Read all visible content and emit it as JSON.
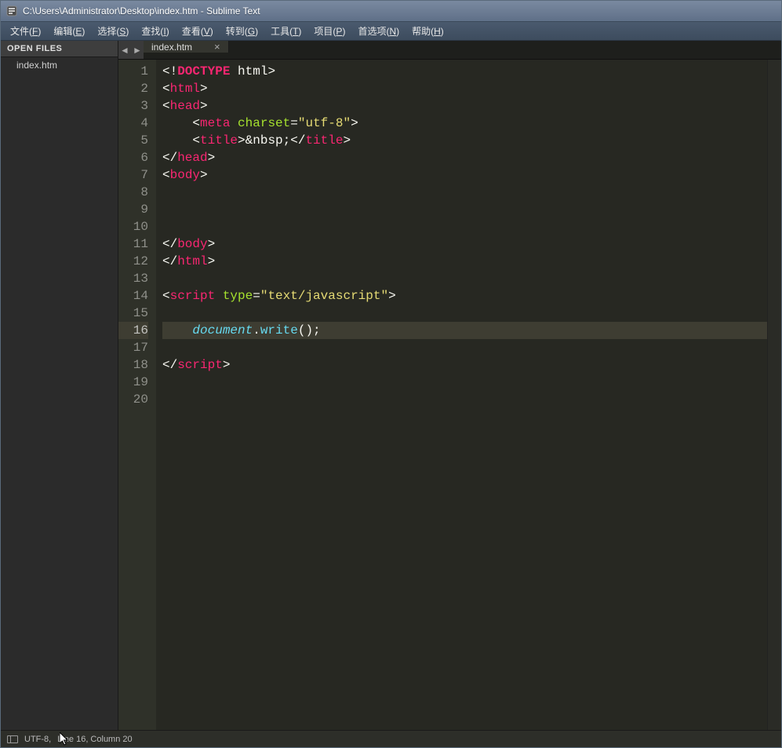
{
  "titlebar": {
    "title": "C:\\Users\\Administrator\\Desktop\\index.htm - Sublime Text"
  },
  "menu": {
    "items": [
      {
        "label": "文件",
        "key": "F"
      },
      {
        "label": "编辑",
        "key": "E"
      },
      {
        "label": "选择",
        "key": "S"
      },
      {
        "label": "查找",
        "key": "I"
      },
      {
        "label": "查看",
        "key": "V"
      },
      {
        "label": "转到",
        "key": "G"
      },
      {
        "label": "工具",
        "key": "T"
      },
      {
        "label": "项目",
        "key": "P"
      },
      {
        "label": "首选项",
        "key": "N"
      },
      {
        "label": "帮助",
        "key": "H"
      }
    ]
  },
  "sidebar": {
    "header": "OPEN FILES",
    "files": [
      "index.htm"
    ]
  },
  "tabs": {
    "items": [
      {
        "label": "index.htm"
      }
    ]
  },
  "editor": {
    "activeLine": 16,
    "lines": [
      {
        "n": 1,
        "tokens": [
          {
            "t": "<!",
            "c": "c-white"
          },
          {
            "t": "DOCTYPE",
            "c": "c-doctype"
          },
          {
            "t": " ",
            "c": "c-white"
          },
          {
            "t": "html",
            "c": "c-white"
          },
          {
            "t": ">",
            "c": "c-white"
          }
        ]
      },
      {
        "n": 2,
        "tokens": [
          {
            "t": "<",
            "c": "c-white"
          },
          {
            "t": "html",
            "c": "c-red"
          },
          {
            "t": ">",
            "c": "c-white"
          }
        ]
      },
      {
        "n": 3,
        "tokens": [
          {
            "t": "<",
            "c": "c-white"
          },
          {
            "t": "head",
            "c": "c-red"
          },
          {
            "t": ">",
            "c": "c-white"
          }
        ]
      },
      {
        "n": 4,
        "tokens": [
          {
            "t": "    <",
            "c": "c-white"
          },
          {
            "t": "meta",
            "c": "c-red"
          },
          {
            "t": " ",
            "c": "c-white"
          },
          {
            "t": "charset",
            "c": "c-attr"
          },
          {
            "t": "=",
            "c": "c-white"
          },
          {
            "t": "\"utf-8\"",
            "c": "c-str"
          },
          {
            "t": ">",
            "c": "c-white"
          }
        ]
      },
      {
        "n": 5,
        "tokens": [
          {
            "t": "    <",
            "c": "c-white"
          },
          {
            "t": "title",
            "c": "c-red"
          },
          {
            "t": ">",
            "c": "c-white"
          },
          {
            "t": "&nbsp;",
            "c": "c-white"
          },
          {
            "t": "</",
            "c": "c-white"
          },
          {
            "t": "title",
            "c": "c-red"
          },
          {
            "t": ">",
            "c": "c-white"
          }
        ]
      },
      {
        "n": 6,
        "tokens": [
          {
            "t": "</",
            "c": "c-white"
          },
          {
            "t": "head",
            "c": "c-red"
          },
          {
            "t": ">",
            "c": "c-white"
          }
        ]
      },
      {
        "n": 7,
        "tokens": [
          {
            "t": "<",
            "c": "c-white"
          },
          {
            "t": "body",
            "c": "c-red"
          },
          {
            "t": ">",
            "c": "c-white"
          }
        ]
      },
      {
        "n": 8,
        "tokens": []
      },
      {
        "n": 9,
        "tokens": []
      },
      {
        "n": 10,
        "tokens": []
      },
      {
        "n": 11,
        "tokens": [
          {
            "t": "</",
            "c": "c-white"
          },
          {
            "t": "body",
            "c": "c-red"
          },
          {
            "t": ">",
            "c": "c-white"
          }
        ]
      },
      {
        "n": 12,
        "tokens": [
          {
            "t": "</",
            "c": "c-white"
          },
          {
            "t": "html",
            "c": "c-red"
          },
          {
            "t": ">",
            "c": "c-white"
          }
        ]
      },
      {
        "n": 13,
        "tokens": []
      },
      {
        "n": 14,
        "tokens": [
          {
            "t": "<",
            "c": "c-white"
          },
          {
            "t": "script",
            "c": "c-red"
          },
          {
            "t": " ",
            "c": "c-white"
          },
          {
            "t": "type",
            "c": "c-attr"
          },
          {
            "t": "=",
            "c": "c-white"
          },
          {
            "t": "\"text/javascript\"",
            "c": "c-str"
          },
          {
            "t": ">",
            "c": "c-white"
          }
        ]
      },
      {
        "n": 15,
        "tokens": []
      },
      {
        "n": 16,
        "tokens": [
          {
            "t": "    ",
            "c": "c-white"
          },
          {
            "t": "document",
            "c": "c-var"
          },
          {
            "t": ".",
            "c": "c-white"
          },
          {
            "t": "write",
            "c": "c-func"
          },
          {
            "t": "();",
            "c": "c-white"
          }
        ]
      },
      {
        "n": 17,
        "tokens": []
      },
      {
        "n": 18,
        "tokens": [
          {
            "t": "</",
            "c": "c-white"
          },
          {
            "t": "script",
            "c": "c-red"
          },
          {
            "t": ">",
            "c": "c-white"
          }
        ]
      },
      {
        "n": 19,
        "tokens": []
      },
      {
        "n": 20,
        "tokens": []
      }
    ]
  },
  "statusbar": {
    "encoding": "UTF-8,",
    "position": "Line 16, Column 20"
  }
}
